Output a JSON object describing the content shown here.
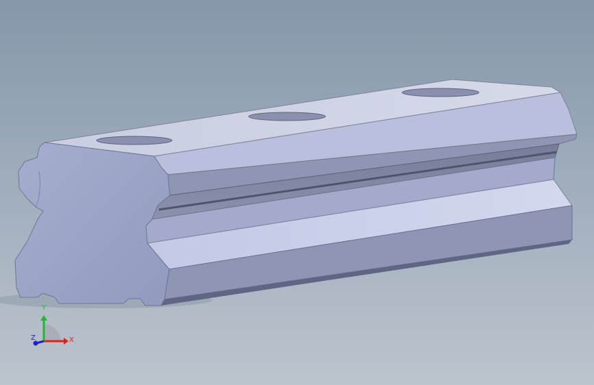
{
  "viewport": {
    "background_top": "#8597a9",
    "background_bottom": "#bcc4cd",
    "model_color": "#9ea6c4"
  },
  "triad": {
    "x_label": "X",
    "y_label": "Y",
    "z_label": "Z",
    "x_color": "#e0201c",
    "y_color": "#22b53a",
    "z_color": "#2020d8"
  }
}
